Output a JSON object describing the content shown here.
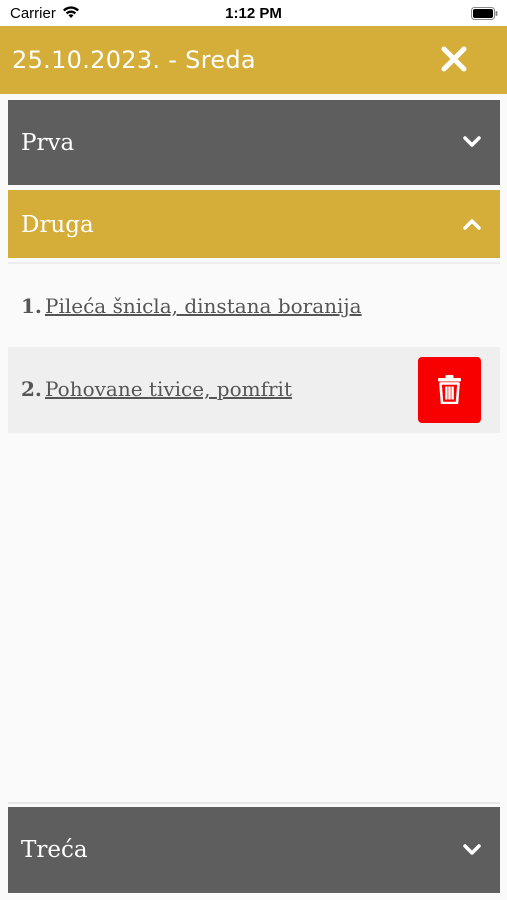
{
  "status_bar": {
    "carrier": "Carrier",
    "time": "1:12 PM",
    "wifi_icon": "wifi-icon",
    "battery_icon": "battery-icon"
  },
  "header": {
    "title": "25.10.2023. - Sreda",
    "close_icon": "close-icon"
  },
  "sections": [
    {
      "label": "Prva",
      "expanded": false,
      "icon": "chevron-down-icon"
    },
    {
      "label": "Druga",
      "expanded": true,
      "icon": "chevron-up-icon"
    },
    {
      "label": "Treća",
      "expanded": false,
      "icon": "chevron-down-icon"
    }
  ],
  "meals": [
    {
      "number": "1.",
      "name": "Pileća šnicla, dinstana boranija"
    },
    {
      "number": "2.",
      "name": "Pohovane tivice, pomfrit",
      "delete_icon": "trash-icon"
    }
  ],
  "colors": {
    "accent": "#d4ae38",
    "section_gray": "#5e5e5e",
    "delete_red": "#f80000"
  }
}
